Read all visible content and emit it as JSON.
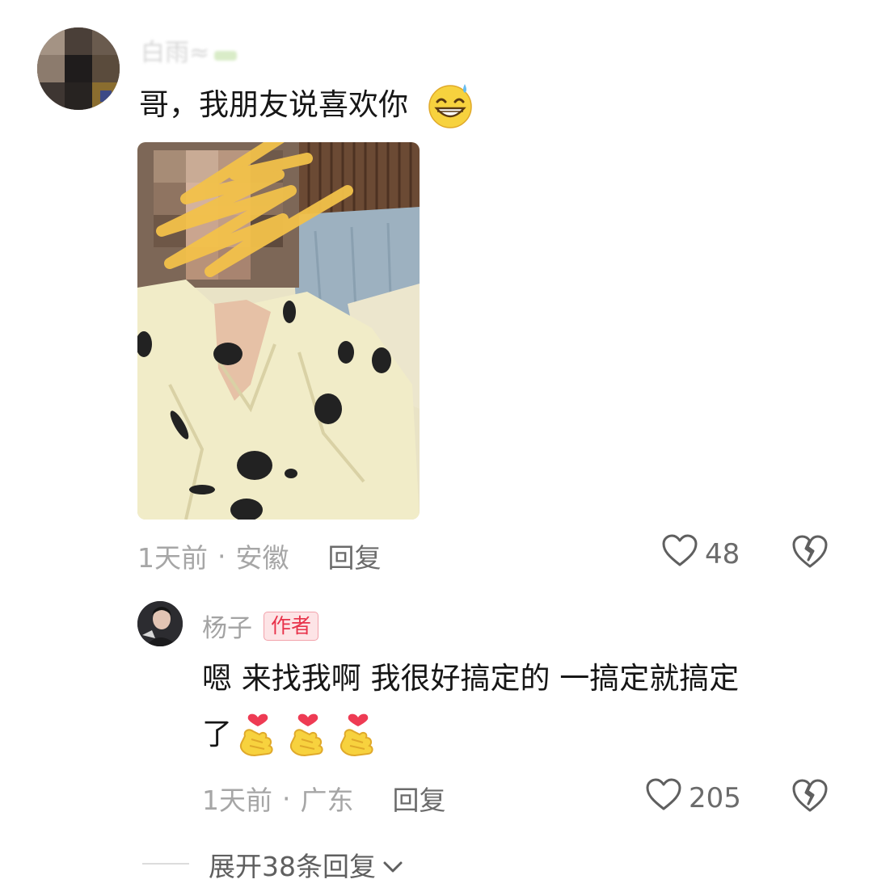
{
  "comment": {
    "username": "白雨≈",
    "text": "哥，我朋友说喜欢你",
    "emoji": "grinning-sweat-emoji",
    "time": "1天前",
    "separator": "·",
    "location": "安徽",
    "reply_label": "回复",
    "likes": "48"
  },
  "reply": {
    "username": "杨子",
    "badge": "作者",
    "text_line1": "嗯 来找我啊 我很好搞定的 一搞定就搞定",
    "text_line2": "了",
    "emojis": [
      "heart-hand-emoji",
      "heart-hand-emoji",
      "heart-hand-emoji"
    ],
    "time": "1天前",
    "separator": "·",
    "location": "广东",
    "reply_label": "回复",
    "likes": "205"
  },
  "expand": {
    "label": "展开38条回复"
  },
  "colors": {
    "text_primary": "#161616",
    "text_secondary": "#a6a6a6",
    "badge_red": "#e8324a",
    "badge_bg": "#fde4e6",
    "emoji_yellow": "#f7d23e"
  }
}
